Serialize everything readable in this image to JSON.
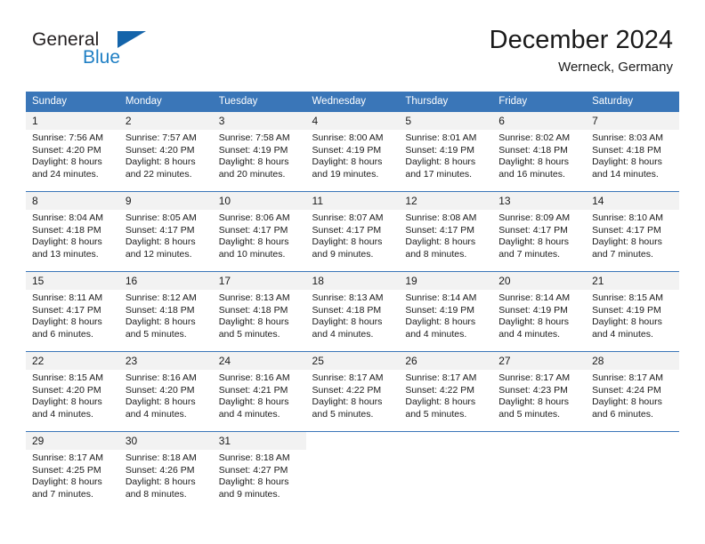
{
  "brand": {
    "name_part1": "General",
    "name_part2": "Blue",
    "triangle_color": "#1464aa",
    "blue_color": "#1f7fc4"
  },
  "header": {
    "title": "December 2024",
    "subtitle": "Werneck, Germany",
    "accent_color": "#3a76b8",
    "daynum_strip_color": "#f2f2f2"
  },
  "calendar": {
    "weekday_headers": [
      "Sunday",
      "Monday",
      "Tuesday",
      "Wednesday",
      "Thursday",
      "Friday",
      "Saturday"
    ],
    "weeks": [
      [
        {
          "day": "1",
          "sunrise": "Sunrise: 7:56 AM",
          "sunset": "Sunset: 4:20 PM",
          "daylight_line1": "Daylight: 8 hours",
          "daylight_line2": "and 24 minutes."
        },
        {
          "day": "2",
          "sunrise": "Sunrise: 7:57 AM",
          "sunset": "Sunset: 4:20 PM",
          "daylight_line1": "Daylight: 8 hours",
          "daylight_line2": "and 22 minutes."
        },
        {
          "day": "3",
          "sunrise": "Sunrise: 7:58 AM",
          "sunset": "Sunset: 4:19 PM",
          "daylight_line1": "Daylight: 8 hours",
          "daylight_line2": "and 20 minutes."
        },
        {
          "day": "4",
          "sunrise": "Sunrise: 8:00 AM",
          "sunset": "Sunset: 4:19 PM",
          "daylight_line1": "Daylight: 8 hours",
          "daylight_line2": "and 19 minutes."
        },
        {
          "day": "5",
          "sunrise": "Sunrise: 8:01 AM",
          "sunset": "Sunset: 4:19 PM",
          "daylight_line1": "Daylight: 8 hours",
          "daylight_line2": "and 17 minutes."
        },
        {
          "day": "6",
          "sunrise": "Sunrise: 8:02 AM",
          "sunset": "Sunset: 4:18 PM",
          "daylight_line1": "Daylight: 8 hours",
          "daylight_line2": "and 16 minutes."
        },
        {
          "day": "7",
          "sunrise": "Sunrise: 8:03 AM",
          "sunset": "Sunset: 4:18 PM",
          "daylight_line1": "Daylight: 8 hours",
          "daylight_line2": "and 14 minutes."
        }
      ],
      [
        {
          "day": "8",
          "sunrise": "Sunrise: 8:04 AM",
          "sunset": "Sunset: 4:18 PM",
          "daylight_line1": "Daylight: 8 hours",
          "daylight_line2": "and 13 minutes."
        },
        {
          "day": "9",
          "sunrise": "Sunrise: 8:05 AM",
          "sunset": "Sunset: 4:17 PM",
          "daylight_line1": "Daylight: 8 hours",
          "daylight_line2": "and 12 minutes."
        },
        {
          "day": "10",
          "sunrise": "Sunrise: 8:06 AM",
          "sunset": "Sunset: 4:17 PM",
          "daylight_line1": "Daylight: 8 hours",
          "daylight_line2": "and 10 minutes."
        },
        {
          "day": "11",
          "sunrise": "Sunrise: 8:07 AM",
          "sunset": "Sunset: 4:17 PM",
          "daylight_line1": "Daylight: 8 hours",
          "daylight_line2": "and 9 minutes."
        },
        {
          "day": "12",
          "sunrise": "Sunrise: 8:08 AM",
          "sunset": "Sunset: 4:17 PM",
          "daylight_line1": "Daylight: 8 hours",
          "daylight_line2": "and 8 minutes."
        },
        {
          "day": "13",
          "sunrise": "Sunrise: 8:09 AM",
          "sunset": "Sunset: 4:17 PM",
          "daylight_line1": "Daylight: 8 hours",
          "daylight_line2": "and 7 minutes."
        },
        {
          "day": "14",
          "sunrise": "Sunrise: 8:10 AM",
          "sunset": "Sunset: 4:17 PM",
          "daylight_line1": "Daylight: 8 hours",
          "daylight_line2": "and 7 minutes."
        }
      ],
      [
        {
          "day": "15",
          "sunrise": "Sunrise: 8:11 AM",
          "sunset": "Sunset: 4:17 PM",
          "daylight_line1": "Daylight: 8 hours",
          "daylight_line2": "and 6 minutes."
        },
        {
          "day": "16",
          "sunrise": "Sunrise: 8:12 AM",
          "sunset": "Sunset: 4:18 PM",
          "daylight_line1": "Daylight: 8 hours",
          "daylight_line2": "and 5 minutes."
        },
        {
          "day": "17",
          "sunrise": "Sunrise: 8:13 AM",
          "sunset": "Sunset: 4:18 PM",
          "daylight_line1": "Daylight: 8 hours",
          "daylight_line2": "and 5 minutes."
        },
        {
          "day": "18",
          "sunrise": "Sunrise: 8:13 AM",
          "sunset": "Sunset: 4:18 PM",
          "daylight_line1": "Daylight: 8 hours",
          "daylight_line2": "and 4 minutes."
        },
        {
          "day": "19",
          "sunrise": "Sunrise: 8:14 AM",
          "sunset": "Sunset: 4:19 PM",
          "daylight_line1": "Daylight: 8 hours",
          "daylight_line2": "and 4 minutes."
        },
        {
          "day": "20",
          "sunrise": "Sunrise: 8:14 AM",
          "sunset": "Sunset: 4:19 PM",
          "daylight_line1": "Daylight: 8 hours",
          "daylight_line2": "and 4 minutes."
        },
        {
          "day": "21",
          "sunrise": "Sunrise: 8:15 AM",
          "sunset": "Sunset: 4:19 PM",
          "daylight_line1": "Daylight: 8 hours",
          "daylight_line2": "and 4 minutes."
        }
      ],
      [
        {
          "day": "22",
          "sunrise": "Sunrise: 8:15 AM",
          "sunset": "Sunset: 4:20 PM",
          "daylight_line1": "Daylight: 8 hours",
          "daylight_line2": "and 4 minutes."
        },
        {
          "day": "23",
          "sunrise": "Sunrise: 8:16 AM",
          "sunset": "Sunset: 4:20 PM",
          "daylight_line1": "Daylight: 8 hours",
          "daylight_line2": "and 4 minutes."
        },
        {
          "day": "24",
          "sunrise": "Sunrise: 8:16 AM",
          "sunset": "Sunset: 4:21 PM",
          "daylight_line1": "Daylight: 8 hours",
          "daylight_line2": "and 4 minutes."
        },
        {
          "day": "25",
          "sunrise": "Sunrise: 8:17 AM",
          "sunset": "Sunset: 4:22 PM",
          "daylight_line1": "Daylight: 8 hours",
          "daylight_line2": "and 5 minutes."
        },
        {
          "day": "26",
          "sunrise": "Sunrise: 8:17 AM",
          "sunset": "Sunset: 4:22 PM",
          "daylight_line1": "Daylight: 8 hours",
          "daylight_line2": "and 5 minutes."
        },
        {
          "day": "27",
          "sunrise": "Sunrise: 8:17 AM",
          "sunset": "Sunset: 4:23 PM",
          "daylight_line1": "Daylight: 8 hours",
          "daylight_line2": "and 5 minutes."
        },
        {
          "day": "28",
          "sunrise": "Sunrise: 8:17 AM",
          "sunset": "Sunset: 4:24 PM",
          "daylight_line1": "Daylight: 8 hours",
          "daylight_line2": "and 6 minutes."
        }
      ],
      [
        {
          "day": "29",
          "sunrise": "Sunrise: 8:17 AM",
          "sunset": "Sunset: 4:25 PM",
          "daylight_line1": "Daylight: 8 hours",
          "daylight_line2": "and 7 minutes."
        },
        {
          "day": "30",
          "sunrise": "Sunrise: 8:18 AM",
          "sunset": "Sunset: 4:26 PM",
          "daylight_line1": "Daylight: 8 hours",
          "daylight_line2": "and 8 minutes."
        },
        {
          "day": "31",
          "sunrise": "Sunrise: 8:18 AM",
          "sunset": "Sunset: 4:27 PM",
          "daylight_line1": "Daylight: 8 hours",
          "daylight_line2": "and 9 minutes."
        },
        {
          "day": "",
          "sunrise": "",
          "sunset": "",
          "daylight_line1": "",
          "daylight_line2": ""
        },
        {
          "day": "",
          "sunrise": "",
          "sunset": "",
          "daylight_line1": "",
          "daylight_line2": ""
        },
        {
          "day": "",
          "sunrise": "",
          "sunset": "",
          "daylight_line1": "",
          "daylight_line2": ""
        },
        {
          "day": "",
          "sunrise": "",
          "sunset": "",
          "daylight_line1": "",
          "daylight_line2": ""
        }
      ]
    ]
  }
}
